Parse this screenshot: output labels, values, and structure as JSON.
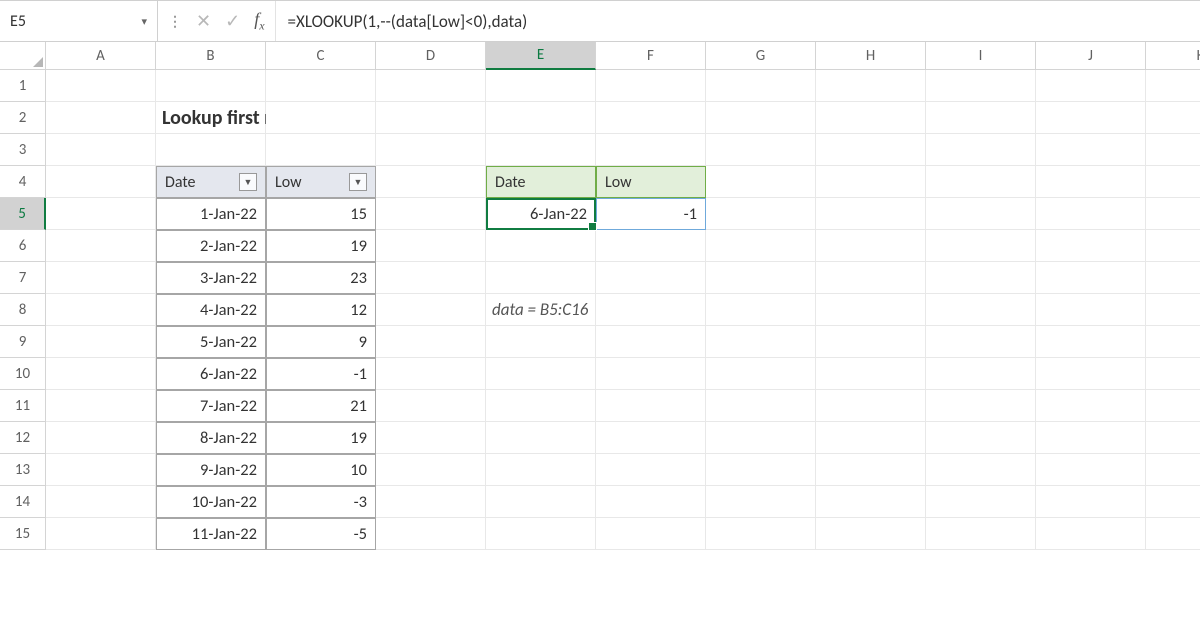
{
  "name_box": "E5",
  "formula": "=XLOOKUP(1,--(data[Low]<0),data)",
  "columns": [
    "A",
    "B",
    "C",
    "D",
    "E",
    "F",
    "G",
    "H",
    "I",
    "J",
    "K"
  ],
  "rows": [
    1,
    2,
    3,
    4,
    5,
    6,
    7,
    8,
    9,
    10,
    11,
    12,
    13,
    14,
    15
  ],
  "active_col": "E",
  "active_row": 5,
  "title": "Lookup first negative value",
  "table": {
    "headers": [
      "Date",
      "Low"
    ],
    "rows": [
      {
        "date": "1-Jan-22",
        "low": 15
      },
      {
        "date": "2-Jan-22",
        "low": 19
      },
      {
        "date": "3-Jan-22",
        "low": 23
      },
      {
        "date": "4-Jan-22",
        "low": 12
      },
      {
        "date": "5-Jan-22",
        "low": 9
      },
      {
        "date": "6-Jan-22",
        "low": -1
      },
      {
        "date": "7-Jan-22",
        "low": 21
      },
      {
        "date": "8-Jan-22",
        "low": 19
      },
      {
        "date": "9-Jan-22",
        "low": 10
      },
      {
        "date": "10-Jan-22",
        "low": -3
      },
      {
        "date": "11-Jan-22",
        "low": -5
      }
    ]
  },
  "result": {
    "headers": [
      "Date",
      "Low"
    ],
    "date": "6-Jan-22",
    "low": -1
  },
  "note": "data = B5:C16"
}
